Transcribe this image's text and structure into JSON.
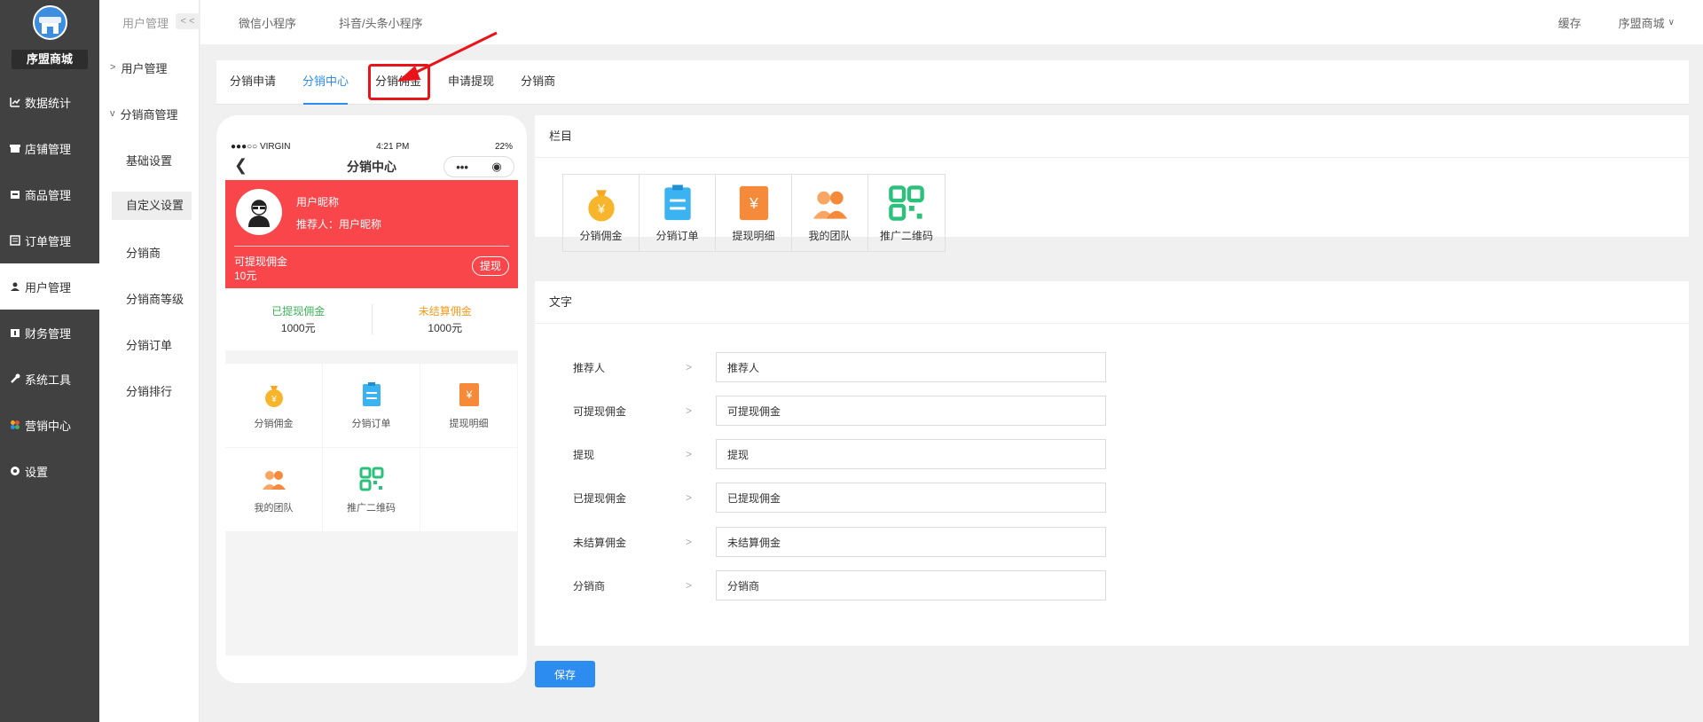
{
  "brand": {
    "name": "序盟商城"
  },
  "sidebar": {
    "items": [
      {
        "label": "数据统计",
        "icon": "chart-icon"
      },
      {
        "label": "店铺管理",
        "icon": "store-icon"
      },
      {
        "label": "商品管理",
        "icon": "goods-icon"
      },
      {
        "label": "订单管理",
        "icon": "order-icon"
      },
      {
        "label": "用户管理",
        "icon": "user-icon",
        "active": true
      },
      {
        "label": "财务管理",
        "icon": "finance-icon"
      },
      {
        "label": "系统工具",
        "icon": "wrench-icon"
      },
      {
        "label": "营销中心",
        "icon": "marketing-icon"
      },
      {
        "label": "设置",
        "icon": "gear-icon"
      }
    ]
  },
  "subnav": {
    "header": "用户管理",
    "collapse": "< <",
    "group1": "用户管理",
    "group2": "分销商管理",
    "items": [
      "基础设置",
      "自定义设置",
      "分销商",
      "分销商等级",
      "分销订单",
      "分销排行"
    ]
  },
  "topbar": {
    "links": [
      "微信小程序",
      "抖音/头条小程序"
    ],
    "right": {
      "cache": "缓存",
      "shop": "序盟商城"
    }
  },
  "tabs": [
    "分销申请",
    "分销中心",
    "分销佣金",
    "申请提现",
    "分销商"
  ],
  "phone": {
    "status": {
      "carrier": "●●●○○ VIRGIN",
      "time": "4:21 PM",
      "battery": "22%"
    },
    "title": "分销中心",
    "card": {
      "nickname": "用户昵称",
      "referrer": "推荐人：用户昵称",
      "withdrawable_label": "可提现佣金",
      "withdrawable_value": "10元",
      "withdraw_btn": "提现"
    },
    "stats": [
      {
        "label": "已提现佣金",
        "value": "1000元",
        "color": "#3eb35a"
      },
      {
        "label": "未结算佣金",
        "value": "1000元",
        "color": "#f29b1d"
      }
    ],
    "grid": [
      "分销佣金",
      "分销订单",
      "提现明细",
      "我的团队",
      "推广二维码"
    ]
  },
  "columns_panel": {
    "title": "栏目",
    "items": [
      "分销佣金",
      "分销订单",
      "提现明细",
      "我的团队",
      "推广二维码"
    ]
  },
  "text_panel": {
    "title": "文字",
    "fields": [
      {
        "label": "推荐人",
        "value": "推荐人"
      },
      {
        "label": "可提现佣金",
        "value": "可提现佣金"
      },
      {
        "label": "提现",
        "value": "提现"
      },
      {
        "label": "已提现佣金",
        "value": "已提现佣金"
      },
      {
        "label": "未结算佣金",
        "value": "未结算佣金"
      },
      {
        "label": "分销商",
        "value": "分销商"
      }
    ]
  },
  "save_label": "保存",
  "colors": {
    "accent": "#2d8cf0",
    "red": "#f8464b",
    "sidebar": "#414141"
  }
}
